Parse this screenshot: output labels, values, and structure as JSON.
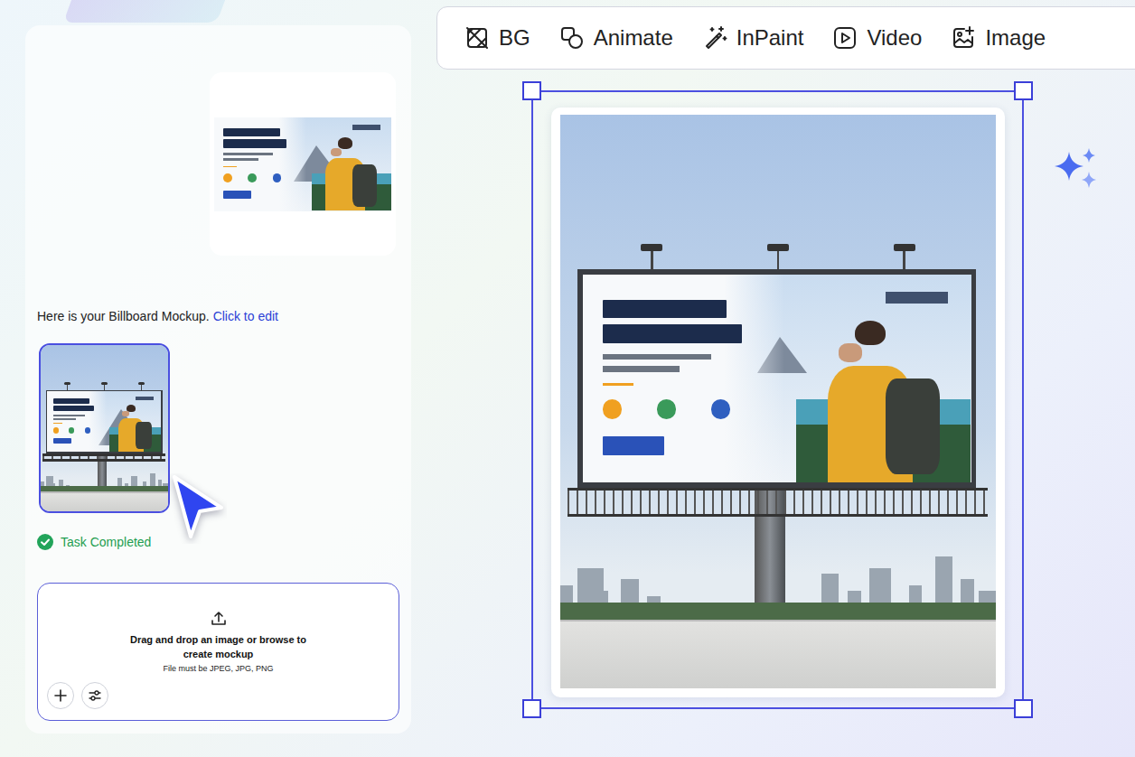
{
  "message": {
    "text": "Here is your Billboard Mockup.",
    "link": "Click to edit"
  },
  "result": {
    "selected": true
  },
  "status": {
    "text": "Task Completed",
    "done": true
  },
  "upload": {
    "title": "Drag and drop an image or browse to",
    "subtitle": "create mockup",
    "note": "File must be JPEG, JPG, PNG"
  },
  "toolbar": [
    {
      "label": "BG",
      "kind": "bg"
    },
    {
      "label": "Animate",
      "kind": "animate"
    },
    {
      "label": "InPaint",
      "kind": "inpaint"
    },
    {
      "label": "Video",
      "kind": "video"
    },
    {
      "label": "Image",
      "kind": "image"
    }
  ],
  "canvas": {
    "selected": true
  }
}
